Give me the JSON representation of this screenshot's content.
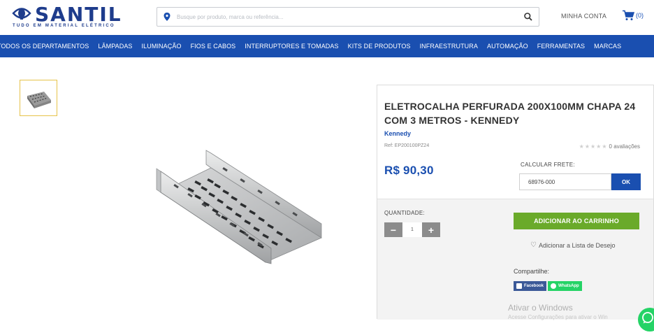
{
  "header": {
    "logo_text": "SANTIL",
    "logo_tagline": "TUDO EM MATERIAL ELÉTRICO",
    "search_placeholder": "Busque por produto, marca ou referência...",
    "account_label": "MINHA CONTA",
    "cart_count": "(0)"
  },
  "nav": {
    "items": [
      "TODOS OS DEPARTAMENTOS",
      "LÂMPADAS",
      "ILUMINAÇÃO",
      "FIOS E CABOS",
      "INTERRUPTORES E TOMADAS",
      "KITS DE PRODUTOS",
      "INFRAESTRUTURA",
      "AUTOMAÇÃO",
      "FERRAMENTAS",
      "MARCAS"
    ]
  },
  "product": {
    "title": "ELETROCALHA PERFURADA 200X100MM CHAPA 24 COM 3 METROS - KENNEDY",
    "brand": "Kennedy",
    "ref": "Ref: EP200100PZ24",
    "stars": "★★★★★",
    "rating_text": "0 avaliações",
    "price": "R$ 90,30",
    "frete_label": "CALCULAR FRETE:",
    "frete_value": "68976-000",
    "frete_button": "OK",
    "qty_label": "QUANTIDADE:",
    "qty_minus": "−",
    "qty_value": "1",
    "qty_plus": "+",
    "add_to_cart": "ADICIONAR AO CARRINHO",
    "wishlist": "Adicionar a Lista de Desejo",
    "share_label": "Compartilhe:",
    "share_facebook": "Facebook",
    "share_whatsapp": "WhatsApp"
  },
  "watermark": {
    "title": "Ativar o Windows",
    "subtitle": "Acesse Configurações para ativar o Win"
  },
  "colors": {
    "brand_blue": "#1a4fb0",
    "add_cart_green": "#6aaa2a",
    "whatsapp_green": "#25d366",
    "facebook_blue": "#3b5998"
  }
}
